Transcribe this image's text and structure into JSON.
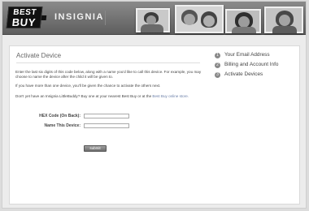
{
  "header": {
    "logo_line1": "BEST",
    "logo_line2": "BUY",
    "brand": "INSIGNIA"
  },
  "main": {
    "title": "Activate Device",
    "instructions": [
      "Enter the last six digits of this code below, along with a name you'd like to call this device. For example, you may choose to name the device after the child it will be given to.",
      "If you have more than one device, you'll be given the chance to activate the others next."
    ],
    "promo_text": "Don't yet have an Insignia LittleBuddy? Buy one at your nearest Best Buy or at the ",
    "promo_link": "Best Buy online store.",
    "form": {
      "hex_label": "HEX Code (On Back):",
      "hex_value": "",
      "name_label": "Name This Device:",
      "name_value": "",
      "submit_label": "submit"
    }
  },
  "steps": [
    {
      "num": "1",
      "label": "Your Email Address"
    },
    {
      "num": "2",
      "label": "Billing and Account Info"
    },
    {
      "num": "3",
      "label": "Activate Devices"
    }
  ],
  "colors": {
    "header_bg": "#6e6e6e",
    "link": "#6b7fa8",
    "step_badge": "#888888",
    "submit_bg": "#7a7a7a"
  }
}
